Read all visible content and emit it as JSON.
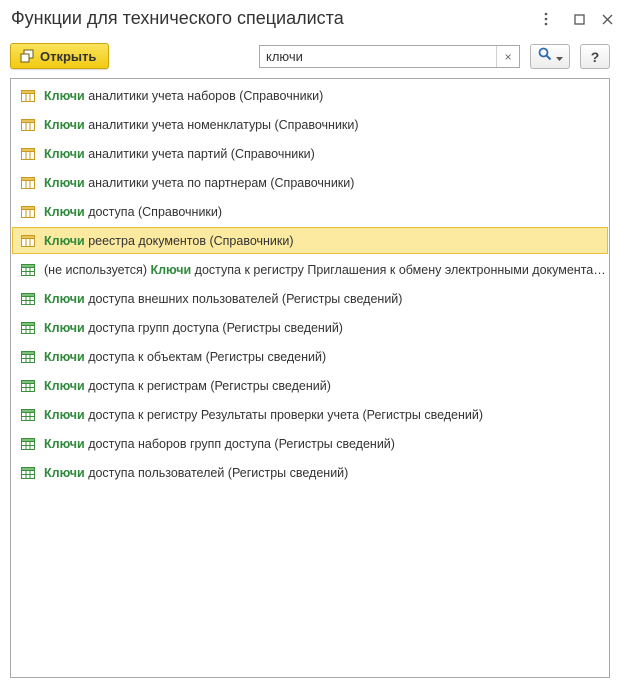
{
  "window": {
    "title": "Функции для технического специалиста",
    "more_icon": "vertical-dots-icon",
    "maximize_icon": "maximize-icon",
    "close_icon": "close-icon"
  },
  "toolbar": {
    "open_label": "Открыть",
    "open_icon": "open-form-icon",
    "search_value": "ключи",
    "search_clear": "×",
    "search_icon": "magnifier-icon",
    "help_label": "?"
  },
  "colors": {
    "accent_button": "#f5d31f",
    "keyword": "#2f8a3c",
    "selected_row": "#fbeaa0",
    "selected_border": "#e8bd3a",
    "catalog_icon": "#c99a1e",
    "register_icon": "#3a8f3a"
  },
  "results": [
    {
      "prefix": "",
      "keyword": "Ключи",
      "rest": " аналитики учета наборов (Справочники)",
      "type": "catalog",
      "selected": false
    },
    {
      "prefix": "",
      "keyword": "Ключи",
      "rest": " аналитики учета номенклатуры (Справочники)",
      "type": "catalog",
      "selected": false
    },
    {
      "prefix": "",
      "keyword": "Ключи",
      "rest": " аналитики учета партий (Справочники)",
      "type": "catalog",
      "selected": false
    },
    {
      "prefix": "",
      "keyword": "Ключи",
      "rest": " аналитики учета по партнерам (Справочники)",
      "type": "catalog",
      "selected": false
    },
    {
      "prefix": "",
      "keyword": "Ключи",
      "rest": " доступа (Справочники)",
      "type": "catalog",
      "selected": false
    },
    {
      "prefix": "",
      "keyword": "Ключи",
      "rest": " реестра документов (Справочники)",
      "type": "catalog",
      "selected": true
    },
    {
      "prefix": "(не используется) ",
      "keyword": "Ключи",
      "rest": " доступа к регистру Приглашения к обмену электронными документами",
      "type": "register",
      "selected": false
    },
    {
      "prefix": "",
      "keyword": "Ключи",
      "rest": " доступа внешних пользователей (Регистры сведений)",
      "type": "register",
      "selected": false
    },
    {
      "prefix": "",
      "keyword": "Ключи",
      "rest": " доступа групп доступа (Регистры сведений)",
      "type": "register",
      "selected": false
    },
    {
      "prefix": "",
      "keyword": "Ключи",
      "rest": " доступа к объектам (Регистры сведений)",
      "type": "register",
      "selected": false
    },
    {
      "prefix": "",
      "keyword": "Ключи",
      "rest": " доступа к регистрам (Регистры сведений)",
      "type": "register",
      "selected": false
    },
    {
      "prefix": "",
      "keyword": "Ключи",
      "rest": " доступа к регистру Результаты проверки учета (Регистры сведений)",
      "type": "register",
      "selected": false
    },
    {
      "prefix": "",
      "keyword": "Ключи",
      "rest": " доступа наборов групп доступа (Регистры сведений)",
      "type": "register",
      "selected": false
    },
    {
      "prefix": "",
      "keyword": "Ключи",
      "rest": " доступа пользователей (Регистры сведений)",
      "type": "register",
      "selected": false
    }
  ]
}
